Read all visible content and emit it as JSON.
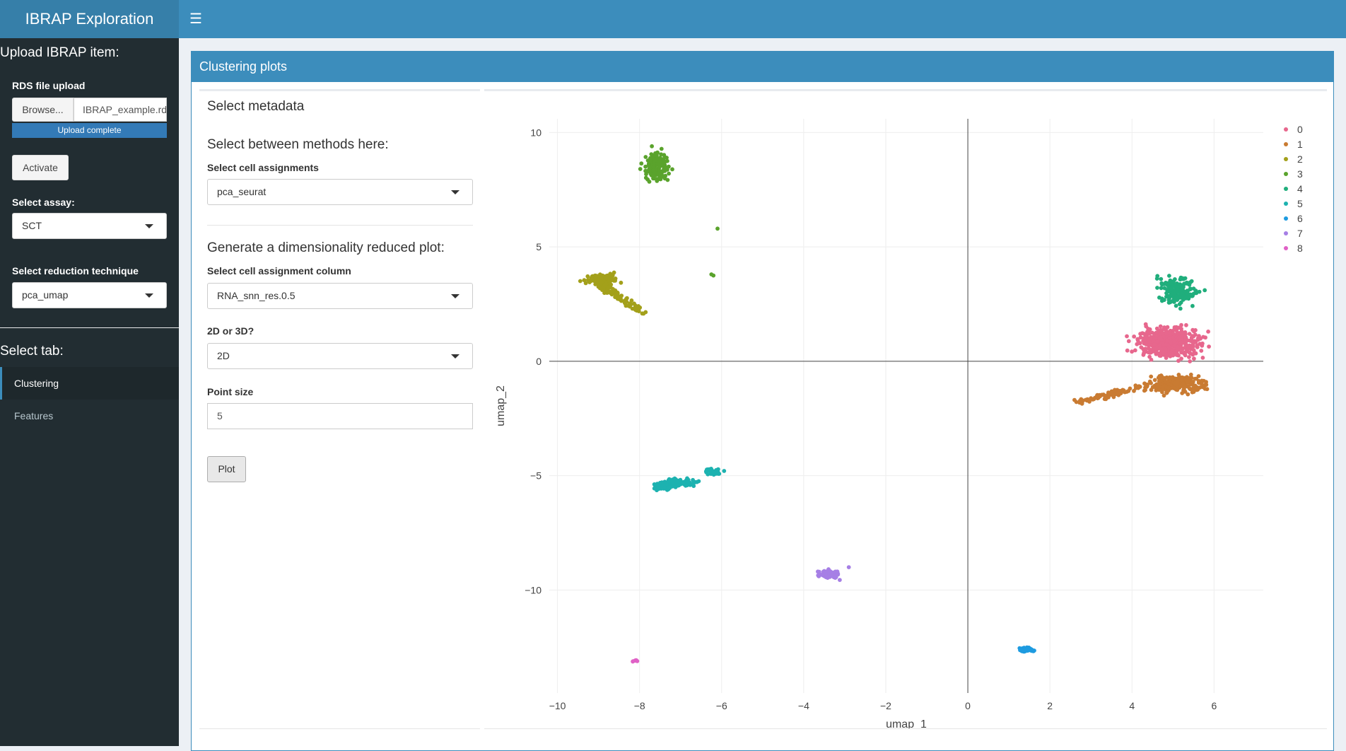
{
  "header": {
    "brand": "IBRAP Exploration",
    "menu_icon": "hamburger-icon"
  },
  "sidebar": {
    "upload_heading": "Upload IBRAP item:",
    "rds_label": "RDS file upload",
    "browse_label": "Browse...",
    "file_name": "IBRAP_example.rds",
    "upload_status": "Upload complete",
    "activate_label": "Activate",
    "assay_label": "Select assay:",
    "assay_value": "SCT",
    "reduction_label": "Select reduction technique",
    "reduction_value": "pca_umap",
    "tab_heading": "Select tab:",
    "tabs": [
      {
        "label": "Clustering",
        "active": true
      },
      {
        "label": "Features",
        "active": false
      }
    ]
  },
  "main": {
    "box_title": "Clustering plots",
    "metadata_heading": "Select metadata",
    "methods_heading": "Select between methods here:",
    "cell_assign_label": "Select cell assignments",
    "cell_assign_value": "pca_seurat",
    "dimred_heading": "Generate a dimensionality reduced plot:",
    "column_label": "Select cell assignment column",
    "column_value": "RNA_snn_res.0.5",
    "dim_label": "2D or 3D?",
    "dim_value": "2D",
    "point_size_label": "Point size",
    "point_size_value": "5",
    "plot_label": "Plot"
  },
  "chart_data": {
    "type": "scatter",
    "xlabel": "umap_1",
    "ylabel": "umap_2",
    "xlim": [
      -10.2,
      7.2
    ],
    "ylim": [
      -14.5,
      10.6
    ],
    "x_ticks": [
      -10,
      -8,
      -6,
      -4,
      -2,
      0,
      2,
      4,
      6
    ],
    "x_tick_labels": [
      "−10",
      "−8",
      "−6",
      "−4",
      "−2",
      "0",
      "2",
      "4",
      "6"
    ],
    "y_ticks": [
      10,
      5,
      0,
      -5,
      -10
    ],
    "y_tick_labels": [
      "10",
      "5",
      "0",
      "−5",
      "−10"
    ],
    "legend_position": "top-right",
    "series": [
      {
        "name": "0",
        "color": "#e7678d",
        "clusters": [
          {
            "cx": 4.9,
            "cy": 0.8,
            "sx": 0.55,
            "sy": 0.45,
            "n": 420
          }
        ]
      },
      {
        "name": "1",
        "color": "#c97b32",
        "clusters": [
          {
            "cx": 5.1,
            "cy": -1.0,
            "sx": 0.45,
            "sy": 0.3,
            "n": 200
          }
        ],
        "streak": {
          "from": [
            2.6,
            -1.8
          ],
          "to": [
            4.8,
            -0.9
          ],
          "n": 90,
          "spread": 0.1
        }
      },
      {
        "name": "2",
        "color": "#a3a01a",
        "clusters": [
          {
            "cx": -8.9,
            "cy": 3.6,
            "sx": 0.28,
            "sy": 0.15,
            "n": 80
          }
        ],
        "streak": {
          "from": [
            -9.2,
            3.7
          ],
          "to": [
            -7.9,
            2.1
          ],
          "n": 110,
          "spread": 0.12
        }
      },
      {
        "name": "3",
        "color": "#5aa32c",
        "clusters": [
          {
            "cx": -7.6,
            "cy": 8.5,
            "sx": 0.2,
            "sy": 0.45,
            "n": 150
          }
        ],
        "points": [
          [
            -6.1,
            5.8
          ],
          [
            -6.25,
            3.8
          ],
          [
            -6.2,
            3.75
          ]
        ]
      },
      {
        "name": "4",
        "color": "#20ae7c",
        "clusters": [
          {
            "cx": 5.1,
            "cy": 3.1,
            "sx": 0.35,
            "sy": 0.45,
            "n": 160
          }
        ]
      },
      {
        "name": "5",
        "color": "#1db2b0",
        "clusters": [
          {
            "cx": -7.1,
            "cy": -5.3,
            "sx": 0.35,
            "sy": 0.12,
            "n": 90
          },
          {
            "cx": -6.2,
            "cy": -4.8,
            "sx": 0.14,
            "sy": 0.12,
            "n": 30
          },
          {
            "cx": -7.4,
            "cy": -5.5,
            "sx": 0.25,
            "sy": 0.1,
            "n": 40
          }
        ]
      },
      {
        "name": "6",
        "color": "#1e9be0",
        "clusters": [
          {
            "cx": 1.45,
            "cy": -12.6,
            "sx": 0.13,
            "sy": 0.06,
            "n": 50
          }
        ]
      },
      {
        "name": "7",
        "color": "#a67fe5",
        "clusters": [
          {
            "cx": -3.4,
            "cy": -9.3,
            "sx": 0.17,
            "sy": 0.12,
            "n": 90
          }
        ],
        "points": [
          [
            -2.9,
            -9.0
          ]
        ]
      },
      {
        "name": "8",
        "color": "#e061c6",
        "clusters": [
          {
            "cx": -8.1,
            "cy": -13.1,
            "sx": 0.04,
            "sy": 0.03,
            "n": 6
          }
        ]
      }
    ]
  }
}
